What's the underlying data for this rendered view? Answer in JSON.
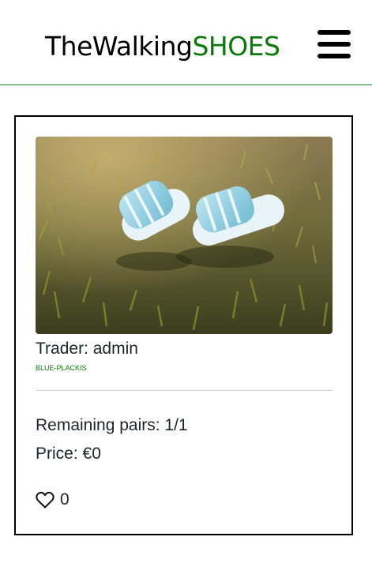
{
  "header": {
    "brand_main": "TheWalking",
    "brand_accent": "SHOES",
    "menu_icon": "hamburger-menu-icon",
    "accent_color": "#0b7a0b"
  },
  "product": {
    "image_alt": "Light blue slide sandals on grass",
    "trader_label": "Trader: admin",
    "tag": "BLUE-PLACKIS",
    "remaining_label": "Remaining pairs: 1/1",
    "price_label": "Price: €0",
    "like_icon": "heart-outline-icon",
    "like_count": "0"
  }
}
